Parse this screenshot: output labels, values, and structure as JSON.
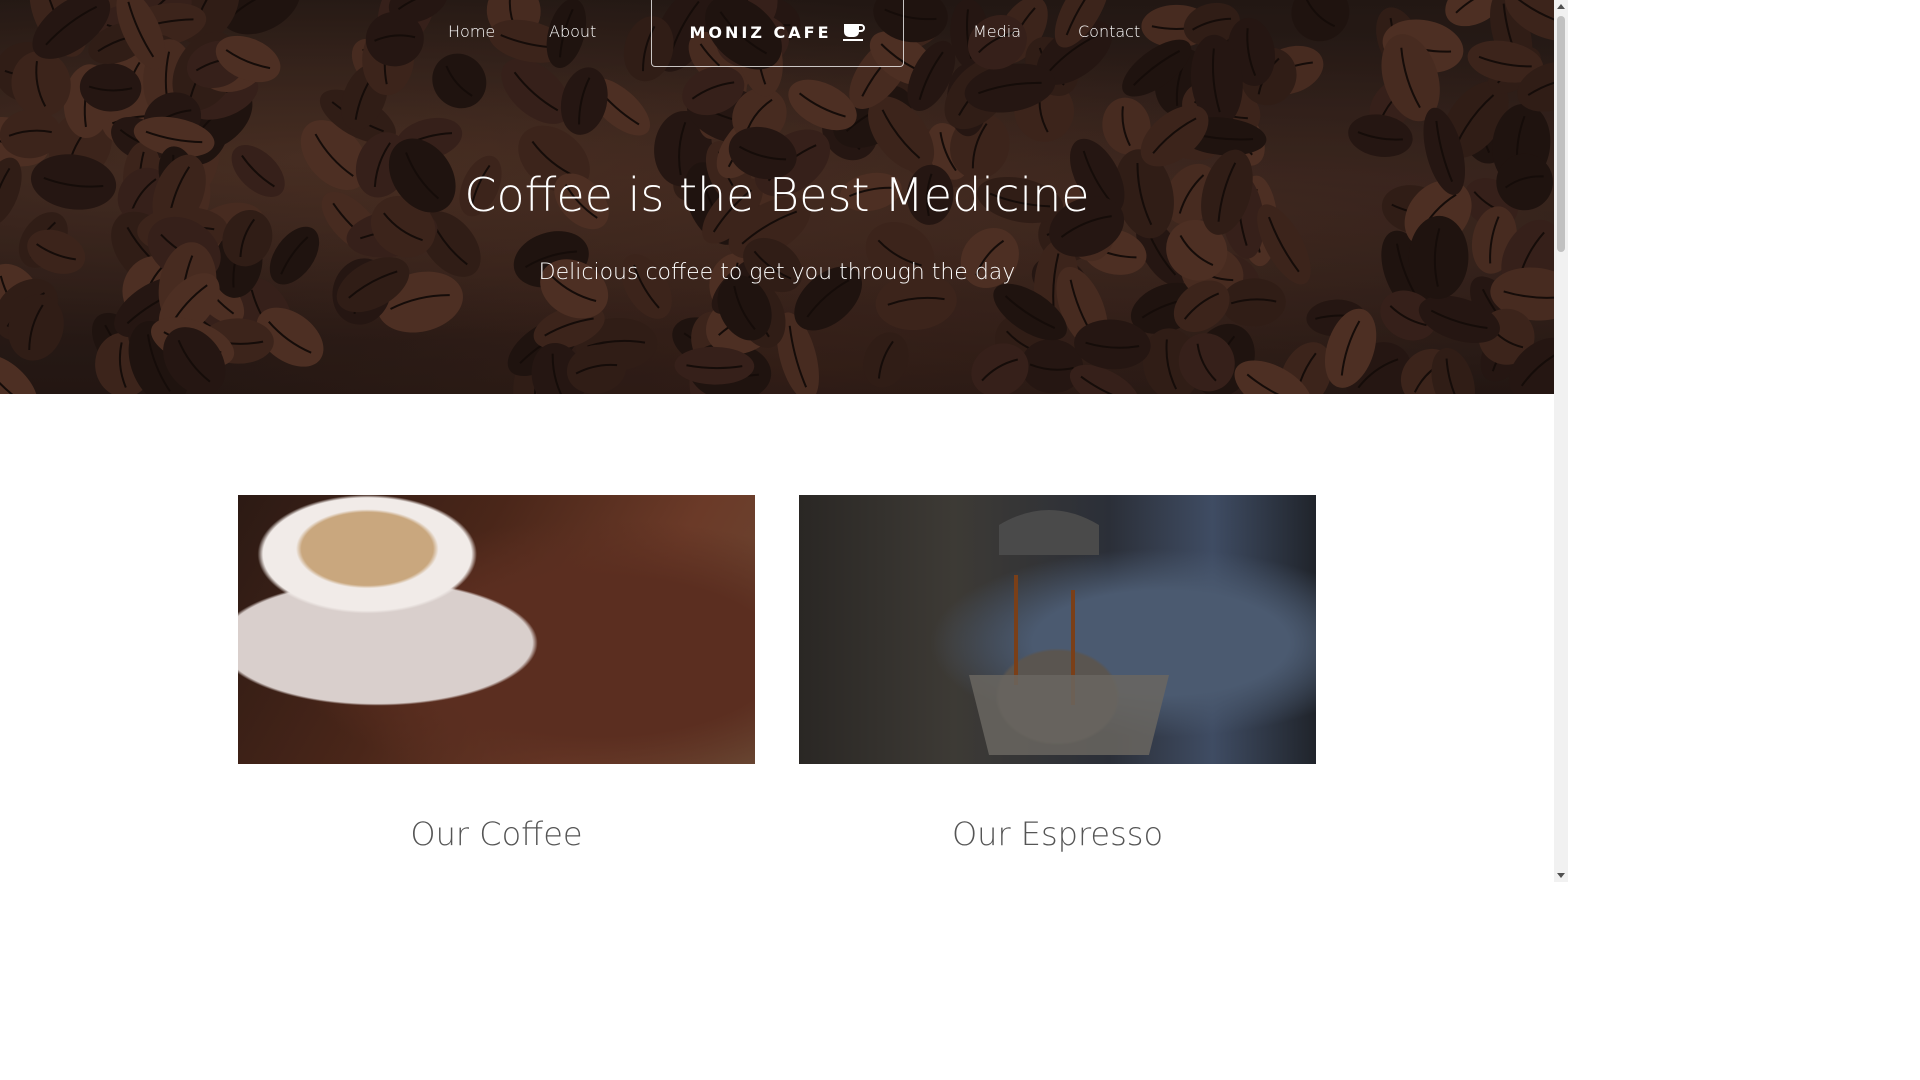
{
  "nav": {
    "left_links": [
      "Home",
      "About"
    ],
    "right_links": [
      "Media",
      "Contact"
    ],
    "brand": "MONIZ CAFE",
    "brand_icon": "coffee-cup-icon"
  },
  "hero": {
    "title": "Coffee is the Best Medicine",
    "subtitle": "Delicious coffee to get you through the day"
  },
  "cards": [
    {
      "title": "Our Coffee",
      "image": "cappuccino-with-beans-photo"
    },
    {
      "title": "Our Espresso",
      "image": "espresso-machine-photo"
    }
  ],
  "colors": {
    "hero_dark": "#2a1d18",
    "card_title": "#555555",
    "nav_text": "#ffffff"
  }
}
